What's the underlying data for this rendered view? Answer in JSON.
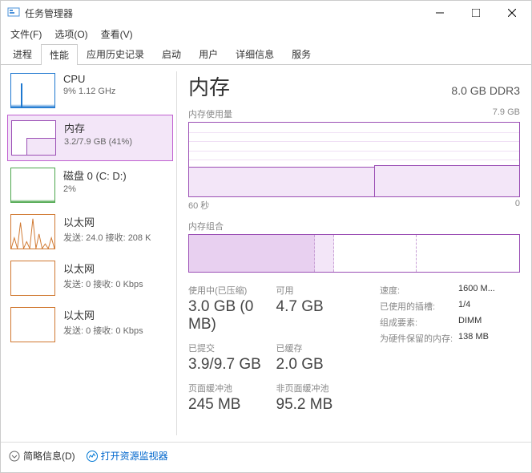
{
  "window": {
    "title": "任务管理器"
  },
  "menu": {
    "file": "文件(F)",
    "options": "选项(O)",
    "view": "查看(V)"
  },
  "tabs": [
    "进程",
    "性能",
    "应用历史记录",
    "启动",
    "用户",
    "详细信息",
    "服务"
  ],
  "active_tab": 1,
  "sidebar": {
    "items": [
      {
        "title": "CPU",
        "sub": "9% 1.12 GHz",
        "thumb": "cpu"
      },
      {
        "title": "内存",
        "sub": "3.2/7.9 GB (41%)",
        "thumb": "mem"
      },
      {
        "title": "磁盘 0 (C: D:)",
        "sub": "2%",
        "thumb": "disk"
      },
      {
        "title": "以太网",
        "sub": "发送: 24.0  接收: 208 K",
        "thumb": "eth1"
      },
      {
        "title": "以太网",
        "sub": "发送: 0  接收: 0 Kbps",
        "thumb": "eth2"
      },
      {
        "title": "以太网",
        "sub": "发送: 0  接收: 0 Kbps",
        "thumb": "eth3"
      }
    ],
    "selected_index": 1
  },
  "main": {
    "title": "内存",
    "spec": "8.0 GB DDR3",
    "usage_label": "内存使用量",
    "usage_max": "7.9 GB",
    "axis_left": "60 秒",
    "axis_right": "0",
    "comp_label": "内存组合",
    "stats": {
      "in_use_label": "使用中(已压缩)",
      "in_use_value": "3.0 GB (0 MB)",
      "available_label": "可用",
      "available_value": "4.7 GB",
      "committed_label": "已提交",
      "committed_value": "3.9/9.7 GB",
      "cached_label": "已缓存",
      "cached_value": "2.0 GB",
      "paged_label": "页面缓冲池",
      "paged_value": "245 MB",
      "nonpaged_label": "非页面缓冲池",
      "nonpaged_value": "95.2 MB"
    },
    "details": {
      "speed_label": "速度:",
      "speed_value": "1600 M...",
      "slots_label": "已使用的插槽:",
      "slots_value": "1/4",
      "form_label": "组成要素:",
      "form_value": "DIMM",
      "reserved_label": "为硬件保留的内存:",
      "reserved_value": "138 MB"
    }
  },
  "footer": {
    "fewer": "简略信息(D)",
    "resmon": "打开资源监视器"
  },
  "chart_data": {
    "type": "line",
    "title": "内存使用量",
    "xlabel": "60 秒 → 0",
    "ylabel": "GB",
    "ylim": [
      0,
      7.9
    ],
    "x": [
      60,
      50,
      40,
      30,
      25,
      20,
      10,
      0
    ],
    "values": [
      3.2,
      3.2,
      3.2,
      3.2,
      3.2,
      3.3,
      3.3,
      3.3
    ],
    "series_name": "内存"
  }
}
